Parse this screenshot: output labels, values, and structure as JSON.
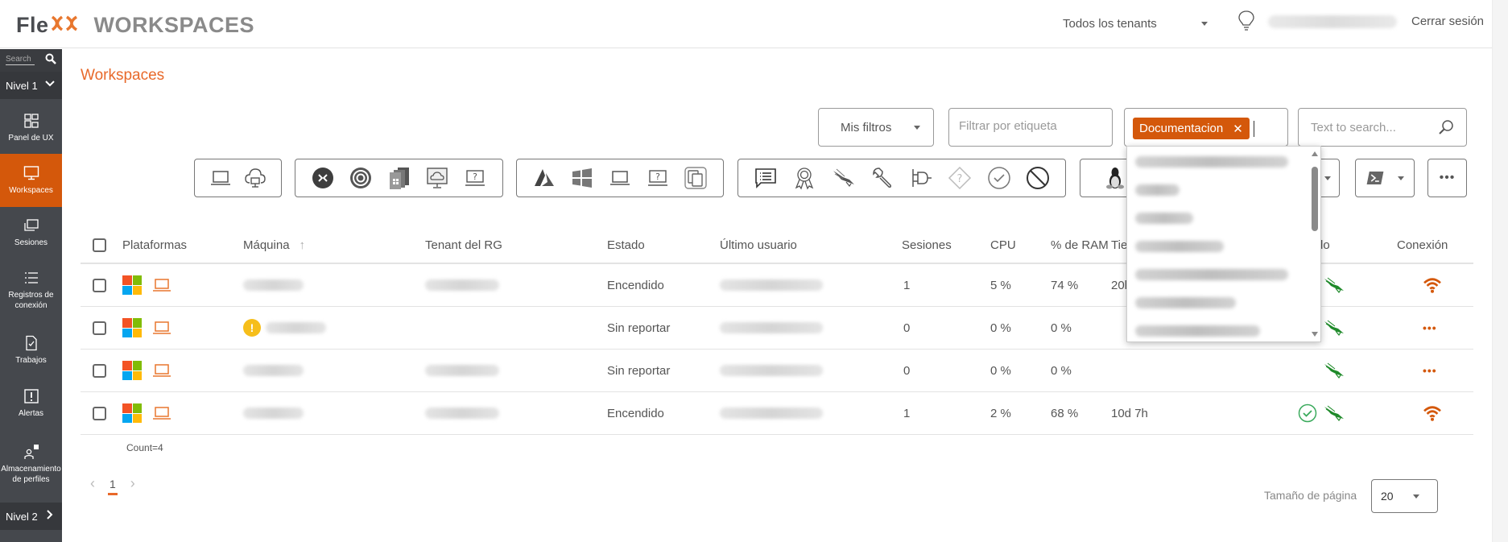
{
  "header": {
    "logo": {
      "part1": "Fle",
      "part2": "xx",
      "part3": "WORKSPACES"
    },
    "tenant_select": "Todos los tenants",
    "logout": "Cerrar sesión"
  },
  "sidebar": {
    "search_placeholder": "Search",
    "level1": "Nivel 1",
    "level2": "Nivel 2",
    "items": [
      {
        "label": "Panel de UX",
        "icon": "dashboard-icon",
        "active": false
      },
      {
        "label": "Workspaces",
        "icon": "monitor-icon",
        "active": true
      },
      {
        "label": "Sesiones",
        "icon": "sessions-icon",
        "active": false
      },
      {
        "label": "Registros de conexión",
        "icon": "list-icon",
        "active": false
      },
      {
        "label": "Trabajos",
        "icon": "job-file-icon",
        "active": false
      },
      {
        "label": "Alertas",
        "icon": "alert-icon",
        "active": false
      },
      {
        "label": "Almacenamiento de perfiles",
        "icon": "profile-storage-icon",
        "active": false
      }
    ]
  },
  "page": {
    "title": "Workspaces"
  },
  "filters": {
    "my_filters": "Mis filtros",
    "tag_filter_placeholder": "Filtrar por etiqueta",
    "selected_tag": "Documentacion",
    "search_placeholder": "Text to search..."
  },
  "toolbar": {
    "groups": [
      [
        "laptop-icon",
        "cloud-desktop-icon"
      ],
      [
        "remote-desktop-icon",
        "citrix-icon",
        "avd-icon",
        "cloud-pc-icon",
        "unknown-device-icon"
      ],
      [
        "azure-icon",
        "windows-icon",
        "laptop-icon",
        "unknown-device-icon",
        "multi-device-icon"
      ],
      [
        "message-list-icon",
        "certificate-icon",
        "crowdstrike-icon",
        "wrench-icon",
        "plug-icon",
        "unknown-diamond-icon",
        "check-circle-icon",
        "ban-icon"
      ],
      [
        "linux-icon"
      ]
    ]
  },
  "tag_dropdown": {
    "items_blurred": 7
  },
  "table": {
    "columns": [
      "Plataformas",
      "Máquina",
      "Tenant del RG",
      "Estado",
      "Último usuario",
      "Sesiones",
      "CPU",
      "% de RAM",
      "Tie",
      "do",
      "Conexión"
    ],
    "sort_indicator": "↑",
    "rows": [
      {
        "estado": "Encendido",
        "sesiones": "1",
        "cpu": "5 %",
        "ram": "74 %",
        "tiempo": "20l",
        "warn": false,
        "check": false,
        "conexion": "wifi"
      },
      {
        "estado": "Sin reportar",
        "sesiones": "0",
        "cpu": "0 %",
        "ram": "0 %",
        "tiempo": "",
        "warn": true,
        "check": false,
        "conexion": "dots"
      },
      {
        "estado": "Sin reportar",
        "sesiones": "0",
        "cpu": "0 %",
        "ram": "0 %",
        "tiempo": "",
        "warn": false,
        "check": false,
        "conexion": "dots"
      },
      {
        "estado": "Encendido",
        "sesiones": "1",
        "cpu": "2 %",
        "ram": "68 %",
        "tiempo": "10d 7h",
        "warn": false,
        "check": true,
        "conexion": "wifi"
      }
    ],
    "count": "Count=4"
  },
  "pagination": {
    "current_page": "1",
    "page_size_label": "Tamaño de página",
    "page_size": "20"
  },
  "colors": {
    "accent": "#d4580b",
    "title": "#e8692a",
    "sidebar": "#45484d",
    "crowdstrike_green": "#1f8a2a"
  }
}
